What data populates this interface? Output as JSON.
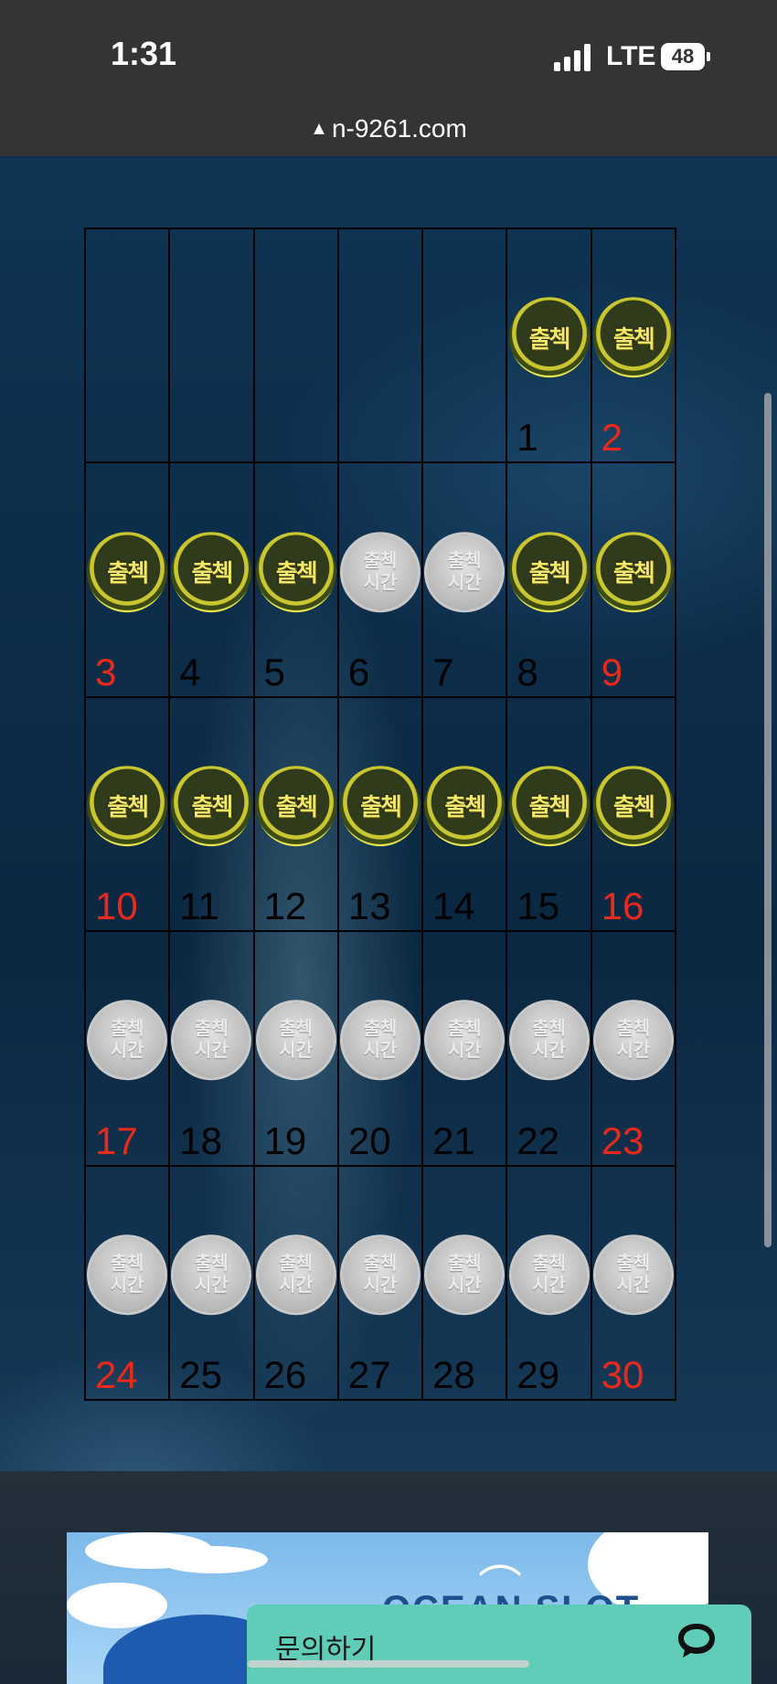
{
  "status_bar": {
    "time": "1:31",
    "network": "LTE",
    "battery": "48"
  },
  "url_bar": {
    "url": "n-9261.com"
  },
  "calendar": {
    "cells": [
      {
        "day": "",
        "stamp": "none",
        "weekend": false
      },
      {
        "day": "",
        "stamp": "none",
        "weekend": false
      },
      {
        "day": "",
        "stamp": "none",
        "weekend": false
      },
      {
        "day": "",
        "stamp": "none",
        "weekend": false
      },
      {
        "day": "",
        "stamp": "none",
        "weekend": false
      },
      {
        "day": "1",
        "stamp": "gold",
        "weekend": false
      },
      {
        "day": "2",
        "stamp": "gold",
        "weekend": true
      },
      {
        "day": "3",
        "stamp": "gold",
        "weekend": true
      },
      {
        "day": "4",
        "stamp": "gold",
        "weekend": false
      },
      {
        "day": "5",
        "stamp": "gold",
        "weekend": false
      },
      {
        "day": "6",
        "stamp": "silver",
        "weekend": false
      },
      {
        "day": "7",
        "stamp": "silver",
        "weekend": false
      },
      {
        "day": "8",
        "stamp": "gold",
        "weekend": false
      },
      {
        "day": "9",
        "stamp": "gold",
        "weekend": true
      },
      {
        "day": "10",
        "stamp": "gold",
        "weekend": true
      },
      {
        "day": "11",
        "stamp": "gold",
        "weekend": false
      },
      {
        "day": "12",
        "stamp": "gold",
        "weekend": false
      },
      {
        "day": "13",
        "stamp": "gold",
        "weekend": false
      },
      {
        "day": "14",
        "stamp": "gold",
        "weekend": false
      },
      {
        "day": "15",
        "stamp": "gold",
        "weekend": false
      },
      {
        "day": "16",
        "stamp": "gold",
        "weekend": true
      },
      {
        "day": "17",
        "stamp": "silver",
        "weekend": true
      },
      {
        "day": "18",
        "stamp": "silver",
        "weekend": false
      },
      {
        "day": "19",
        "stamp": "silver",
        "weekend": false
      },
      {
        "day": "20",
        "stamp": "silver",
        "weekend": false
      },
      {
        "day": "21",
        "stamp": "silver",
        "weekend": false
      },
      {
        "day": "22",
        "stamp": "silver",
        "weekend": false
      },
      {
        "day": "23",
        "stamp": "silver",
        "weekend": true
      },
      {
        "day": "24",
        "stamp": "silver",
        "weekend": true
      },
      {
        "day": "25",
        "stamp": "silver",
        "weekend": false
      },
      {
        "day": "26",
        "stamp": "silver",
        "weekend": false
      },
      {
        "day": "27",
        "stamp": "silver",
        "weekend": false
      },
      {
        "day": "28",
        "stamp": "silver",
        "weekend": false
      },
      {
        "day": "29",
        "stamp": "silver",
        "weekend": false
      },
      {
        "day": "30",
        "stamp": "silver",
        "weekend": true
      }
    ],
    "gold_stamp_text": "출첵",
    "silver_stamp_line1": "출첵",
    "silver_stamp_line2": "시간"
  },
  "banner": {
    "title": "OCEAN SLOT"
  },
  "inquiry": {
    "label": "문의하기",
    "icon": "chat-bubble-icon"
  },
  "colors": {
    "weekend": "#e8291c",
    "weekday": "#000000",
    "widget": "#5fcdb8"
  }
}
